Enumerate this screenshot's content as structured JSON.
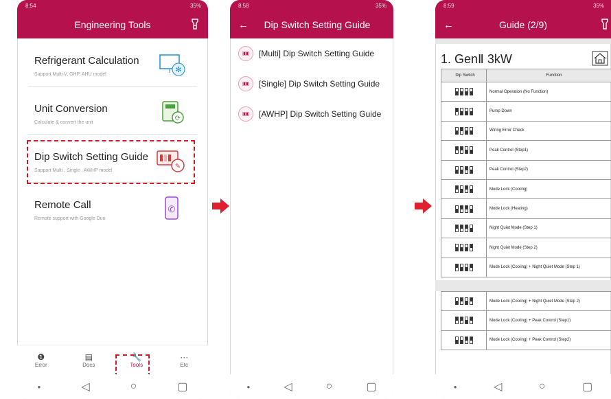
{
  "colors": {
    "brand": "#b5114d",
    "highlight": "#d01a2a",
    "arrow": "#e0202e"
  },
  "screen1": {
    "status": {
      "time": "8:54",
      "battery": "35%"
    },
    "title": "Engineering Tools",
    "items": [
      {
        "title": "Refrigerant Calculation",
        "subtitle": "Support Multi V, GHP, AHU model",
        "icon": "monitor-snowflake-icon"
      },
      {
        "title": "Unit Conversion",
        "subtitle": "Calculate & convert the unit",
        "icon": "calculator-icon"
      },
      {
        "title": "Dip Switch Setting Guide",
        "subtitle": "Support Multi , Single , AWHP model",
        "icon": "dip-switch-wrench-icon"
      },
      {
        "title": "Remote Call",
        "subtitle": "Remote support with Google Duo",
        "icon": "phone-icon"
      }
    ],
    "nav": [
      {
        "label": "Error",
        "icon": "error-icon"
      },
      {
        "label": "Docs",
        "icon": "docs-icon"
      },
      {
        "label": "Tools",
        "icon": "wrench-icon",
        "active": true
      },
      {
        "label": "Etc",
        "icon": "more-icon"
      }
    ]
  },
  "screen2": {
    "status": {
      "time": "8:58",
      "battery": "35%"
    },
    "title": "Dip Switch Setting Guide",
    "items": [
      "[Multi] Dip Switch Setting Guide",
      "[Single] Dip Switch Setting Guide",
      "[AWHP] Dip Switch Setting Guide"
    ]
  },
  "screen3": {
    "status": {
      "time": "8:59",
      "battery": "35%"
    },
    "title": "Guide (2/9)",
    "doc_title": "1. GenⅡ 3kW",
    "headers": [
      "Dip Switch",
      "Function"
    ],
    "rows": [
      {
        "sw": [
          0,
          0,
          0,
          0
        ],
        "fn": "Normal Operation (No Function)"
      },
      {
        "sw": [
          1,
          0,
          0,
          0
        ],
        "fn": "Pump Down"
      },
      {
        "sw": [
          0,
          1,
          0,
          0
        ],
        "fn": "Wiring Error Check"
      },
      {
        "sw": [
          1,
          1,
          0,
          0
        ],
        "fn": "Peak Control (Step1)"
      },
      {
        "sw": [
          0,
          0,
          1,
          0
        ],
        "fn": "Peak Control (Step2)"
      },
      {
        "sw": [
          1,
          0,
          1,
          0
        ],
        "fn": "Mode Lock (Cooling)"
      },
      {
        "sw": [
          0,
          1,
          1,
          0
        ],
        "fn": "Mode Lock (Heating)"
      },
      {
        "sw": [
          1,
          1,
          1,
          0
        ],
        "fn": "Night Quiet Mode (Step 1)"
      },
      {
        "sw": [
          0,
          0,
          0,
          1
        ],
        "fn": "Night Quiet Mode (Step 2)"
      },
      {
        "sw": [
          1,
          0,
          0,
          1
        ],
        "fn": "Mode Lock (Cooling) + Night Quiet Mode (Step 1)"
      }
    ],
    "rows2": [
      {
        "sw": [
          0,
          1,
          0,
          1
        ],
        "fn": "Mode Lock (Cooling) + Night Quiet Mode (Step 2)"
      },
      {
        "sw": [
          1,
          1,
          0,
          1
        ],
        "fn": "Mode Lock (Cooling) + Peak Control (Step1)"
      },
      {
        "sw": [
          0,
          0,
          1,
          1
        ],
        "fn": "Mode Lock (Cooling) + Peak Control (Step2)"
      }
    ]
  }
}
